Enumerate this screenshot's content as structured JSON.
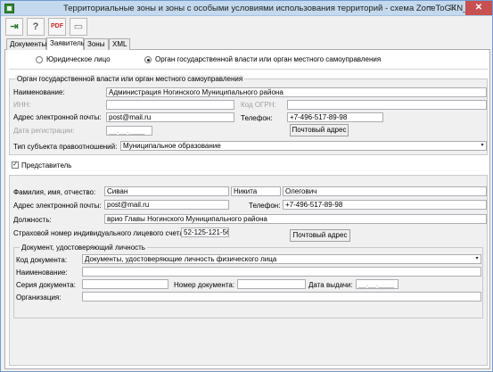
{
  "window": {
    "title": "Территориальные зоны и зоны с особыми условиями использования территорий - схема ZoneToGKN_v03",
    "minimize": "−",
    "maximize": "□",
    "close": "✕"
  },
  "toolbar": {
    "exit_icon": "exit-icon",
    "help_icon": "help-icon",
    "pdf_icon": "pdf-icon",
    "blank_icon": "blank-page-icon",
    "exit_glyph": "⇥",
    "help_glyph": "?",
    "pdf_glyph": "PDF",
    "blank_glyph": "▭"
  },
  "tabs": [
    {
      "label": "Документы"
    },
    {
      "label": "Заявитель"
    },
    {
      "label": "Зоны"
    },
    {
      "label": "XML"
    }
  ],
  "applicant_type": {
    "option_legal": "Юридическое лицо",
    "option_authority": "Орган государственной власти или орган местного самоуправления",
    "selected": "Орган государственной власти или орган местного самоуправления"
  },
  "authority": {
    "legend": "Орган государственной власти или орган местного самоуправления",
    "name_label": "Наименование:",
    "name_value": "Администрация Ногинского Муниципального района",
    "inn_label": "ИНН:",
    "inn_value": "",
    "ogrn_label": "Код ОГРН:",
    "ogrn_value": "",
    "email_label": "Адрес электронной почты:",
    "email_value": "post@mail.ru",
    "phone_label": "Телефон:",
    "phone_value": "+7-496-517-89-98",
    "reg_date_label": "Дата регистрации:",
    "reg_date_value": "__.__.____",
    "postal_button": "Почтовый адрес",
    "subject_type_label": "Тип субъекта правоотношений:",
    "subject_type_value": "Муниципальное образование"
  },
  "representative": {
    "checkbox_label": "Представитель",
    "checked": true,
    "fio_label": "Фамилия, имя, отчество:",
    "last_name": "Сиван",
    "first_name": "Никита",
    "middle_name": "Олегович",
    "email_label": "Адрес электронной почты:",
    "email_value": "post@mail.ru",
    "phone_label": "Телефон:",
    "phone_value": "+7-496-517-89-98",
    "position_label": "Должность:",
    "position_value": "врио Главы Ногинского Муниципального района",
    "snils_label": "Страховой номер индивидуального лицевого счета :",
    "snils_value": "52-125-121-56",
    "postal_button": "Почтовый адрес"
  },
  "identity_doc": {
    "legend": "Документ, удостоверяющий личность",
    "code_label": "Код документа:",
    "code_value": "Документы, удостоверяющие личность физического лица",
    "name_label": "Наименование:",
    "name_value": "",
    "series_label": "Серия документа:",
    "series_value": "",
    "number_label": "Номер документа:",
    "number_value": "",
    "issue_date_label": "Дата выдачи:",
    "issue_date_value": "__.__.____",
    "org_label": "Организация:",
    "org_value": ""
  },
  "icons": {
    "combo_arrow": "▾",
    "checkmark": "✓"
  }
}
